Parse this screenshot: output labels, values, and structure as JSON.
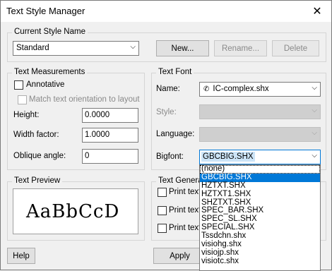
{
  "window": {
    "title": "Text Style Manager",
    "close_glyph": "✕"
  },
  "current_style": {
    "group_label": "Current Style Name",
    "selected": "Standard",
    "new_label": "New...",
    "rename_label": "Rename...",
    "delete_label": "Delete"
  },
  "measurements": {
    "group_label": "Text Measurements",
    "annotative_label": "Annotative",
    "match_label": "Match text orientation to layout",
    "height_label": "Height:",
    "height_value": "0.0000",
    "width_label": "Width factor:",
    "width_value": "1.0000",
    "oblique_label": "Oblique angle:",
    "oblique_value": "0"
  },
  "font": {
    "group_label": "Text Font",
    "name_label": "Name:",
    "name_value": "IC-complex.shx",
    "style_label": "Style:",
    "language_label": "Language:",
    "bigfont_label": "Bigfont:",
    "bigfont_value": "GBCBIG.SHX"
  },
  "preview": {
    "group_label": "Text Preview",
    "sample": "AaBbCcD"
  },
  "generation": {
    "group_label": "Text Genera",
    "opt1": "Print text",
    "opt2": "Print text",
    "opt3": "Print text"
  },
  "footer": {
    "help_label": "Help",
    "apply_label": "Apply"
  },
  "bigfont_options": [
    "(none)",
    "GBCBIG.SHX",
    "HZTXT.SHX",
    "HZTXT1.SHX",
    "SHZTXT.SHX",
    "SPEC_BAR.SHX",
    "SPEC_SL.SHX",
    "SPECIAL.SHX",
    "Tssdchn.shx",
    "visiohg.shx",
    "visiojp.shx",
    "visiotc.shx"
  ],
  "bigfont_selected_index": 1,
  "colors": {
    "accent": "#0078d7",
    "selection_bg": "#cce4f7",
    "window_bg": "#f0f0f0"
  }
}
